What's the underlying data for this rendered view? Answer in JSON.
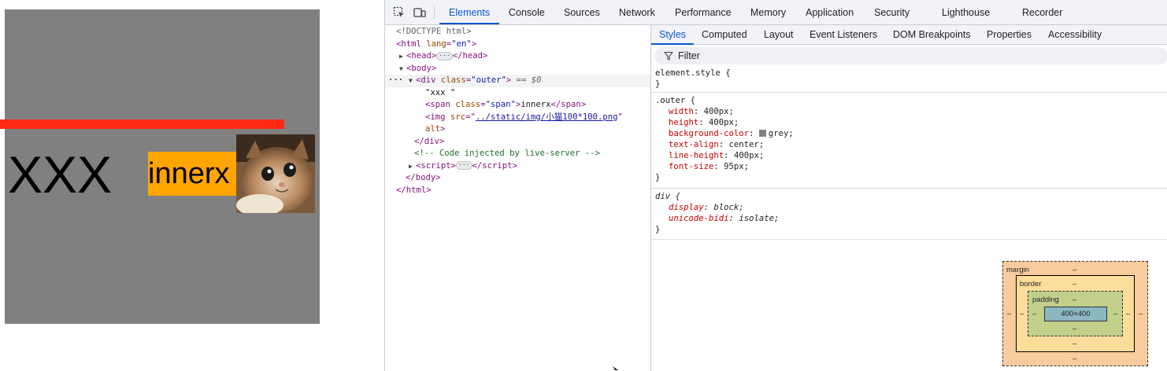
{
  "preview": {
    "outer_text": "XXX",
    "span_text": "innerx",
    "image_alt": "cat"
  },
  "devtools": {
    "main_tabs": [
      "Elements",
      "Console",
      "Sources",
      "Network",
      "Performance",
      "Memory",
      "Application",
      "Security",
      "Lighthouse",
      "Recorder"
    ],
    "active_main_tab": "Elements",
    "dom": {
      "doctype": "<!DOCTYPE html>",
      "html_tag": "html",
      "html_attr": "lang",
      "html_val": "\"en\"",
      "head_tag": "head",
      "body_tag": "body",
      "div_tag": "div",
      "div_attr": "class",
      "div_val": "\"outer\"",
      "selected_marker": "== $0",
      "text_node": "\"xxx \"",
      "span_tag": "span",
      "span_attr": "class",
      "span_val": "\"span\"",
      "span_text": "innerx",
      "img_tag": "img",
      "img_attr": "src",
      "img_src": "../static/img/小猫100*100.png",
      "img_alt_attr": "alt",
      "comment": "<!-- Code injected by live-server -->",
      "script_tag": "script",
      "ellipsis": "···"
    },
    "sub_tabs": [
      "Styles",
      "Computed",
      "Layout",
      "Event Listeners",
      "DOM Breakpoints",
      "Properties",
      "Accessibility"
    ],
    "active_sub_tab": "Styles",
    "filter_label": "Filter",
    "rules": {
      "element_style": {
        "selector": "element.style {",
        "close": "}"
      },
      "outer": {
        "selector": ".outer {",
        "props": [
          {
            "name": "width",
            "value": "400px;"
          },
          {
            "name": "height",
            "value": "400px;"
          },
          {
            "name": "background-color",
            "value": "grey;"
          },
          {
            "name": "text-align",
            "value": "center;"
          },
          {
            "name": "line-height",
            "value": "400px;"
          },
          {
            "name": "font-size",
            "value": "95px;"
          }
        ],
        "close": "}"
      },
      "div": {
        "selector": "div {",
        "props": [
          {
            "name": "display",
            "value": "block;"
          },
          {
            "name": "unicode-bidi",
            "value": "isolate;"
          }
        ],
        "close": "}"
      }
    },
    "box_model": {
      "margin_label": "margin",
      "border_label": "border",
      "padding_label": "padding",
      "content_size": "400×400",
      "dash": "–"
    },
    "colors": {
      "accent": "#0b57d0",
      "swatch_grey": "#808080",
      "red_line": "#ff2a14",
      "span_bg": "#ffa500"
    }
  }
}
